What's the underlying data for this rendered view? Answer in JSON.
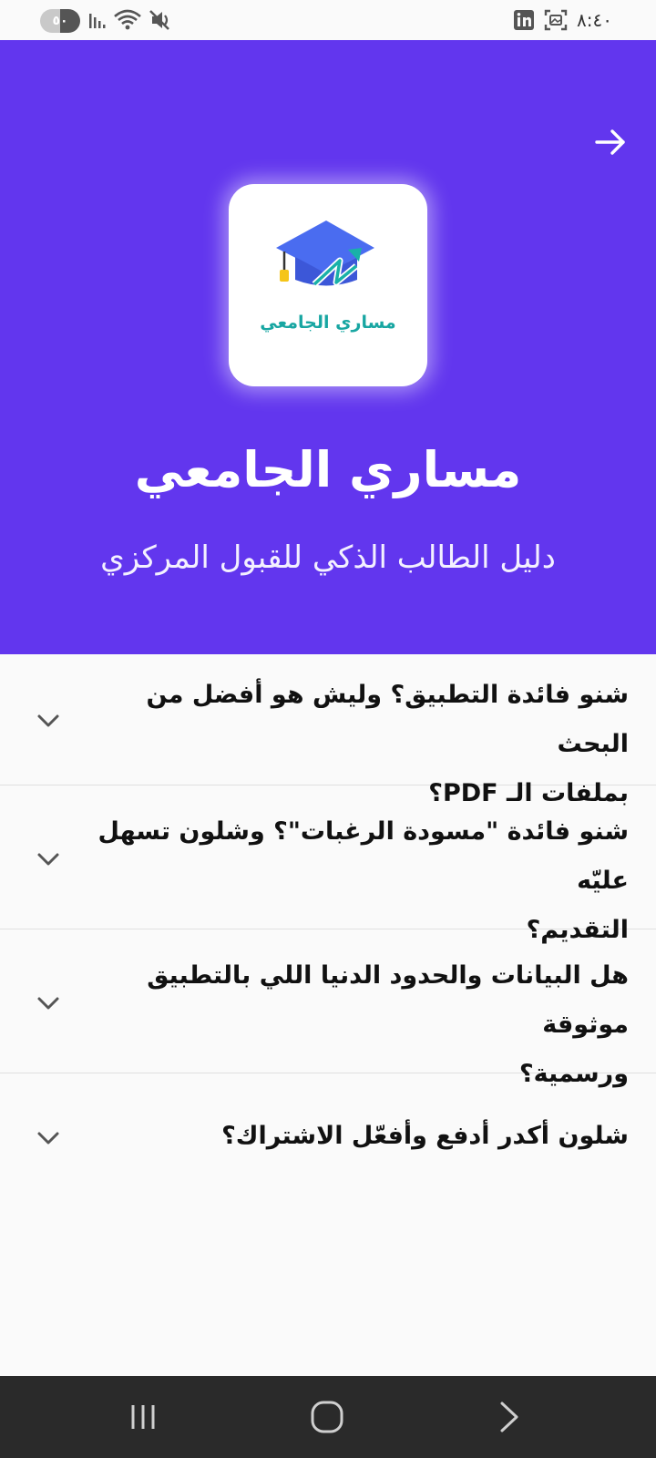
{
  "status_bar": {
    "battery_level": "٥٠",
    "time": "٨:٤٠",
    "icons": [
      "signal-icon",
      "wifi-icon",
      "mute-icon",
      "linkedin-icon",
      "screenshot-icon"
    ]
  },
  "header": {
    "back_icon": "arrow-right-icon",
    "app_icon_label": "مساري الجامعي",
    "title": "مساري الجامعي",
    "subtitle": "دليل الطالب الذكي للقبول المركزي",
    "background_color": "#6236ee"
  },
  "faq": {
    "items": [
      {
        "line1": "شنو فائدة التطبيق؟ وليش هو أفضل من البحث",
        "line2": "بملفات الـ PDF؟"
      },
      {
        "line1": "شنو فائدة \"مسودة الرغبات\"؟ وشلون تسهل عليّه",
        "line2": "التقديم؟"
      },
      {
        "line1": "هل البيانات والحدود الدنيا اللي بالتطبيق موثوقة",
        "line2": "ورسمية؟"
      },
      {
        "line1": "شلون أكدر أدفع وأفعّل الاشتراك؟",
        "line2": ""
      }
    ],
    "expand_icon": "chevron-down-icon"
  },
  "nav_bar": {
    "icons": [
      "recent-apps-icon",
      "home-icon",
      "back-icon"
    ]
  }
}
